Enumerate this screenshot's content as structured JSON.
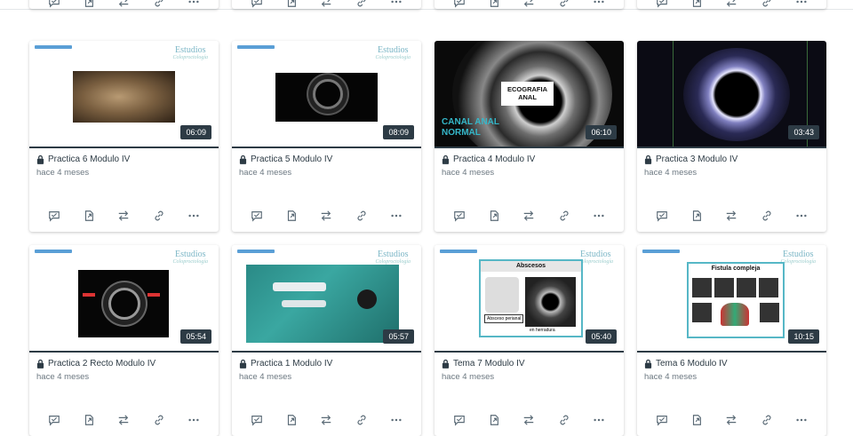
{
  "cards_top_partial": [
    {},
    {},
    {},
    {}
  ],
  "cards": [
    {
      "title": "Practica 6 Modulo IV",
      "meta": "hace 4 meses",
      "duration": "06:09",
      "brand": "Estudios"
    },
    {
      "title": "Practica 5 Modulo IV",
      "meta": "hace 4 meses",
      "duration": "08:09",
      "brand": "Estudios"
    },
    {
      "title": "Practica 4 Modulo IV",
      "meta": "hace 4 meses",
      "duration": "06:10",
      "overlay_title": "ECOGRAFIA\nANAL",
      "overlay_label": "CANAL ANAL\nNORMAL"
    },
    {
      "title": "Practica 3 Modulo IV",
      "meta": "hace 4 meses",
      "duration": "03:43"
    },
    {
      "title": "Practica 2 Recto Modulo IV",
      "meta": "hace 4 meses",
      "duration": "05:54",
      "brand": "Estudios"
    },
    {
      "title": "Practica 1 Modulo IV",
      "meta": "hace 4 meses",
      "duration": "05:57",
      "brand": "Estudios"
    },
    {
      "title": "Tema 7 Modulo IV",
      "meta": "hace 4 meses",
      "duration": "05:40",
      "brand": "Estudios",
      "slide_title": "Abscesos",
      "slide_labels": [
        "Absceso perianal",
        "en herradura"
      ]
    },
    {
      "title": "Tema 6 Modulo IV",
      "meta": "hace 4 meses",
      "duration": "10:15",
      "brand": "Estudios",
      "slide_title": "Fistula compleja"
    }
  ],
  "actions": [
    {
      "icon": "quiz-check-icon"
    },
    {
      "icon": "open-external-icon"
    },
    {
      "icon": "swap-arrows-icon"
    },
    {
      "icon": "link-icon"
    },
    {
      "icon": "more-options-icon"
    }
  ],
  "colors": {
    "accent": "#2d3b45",
    "muted": "#6b7780",
    "teal": "#7bb6c6"
  }
}
